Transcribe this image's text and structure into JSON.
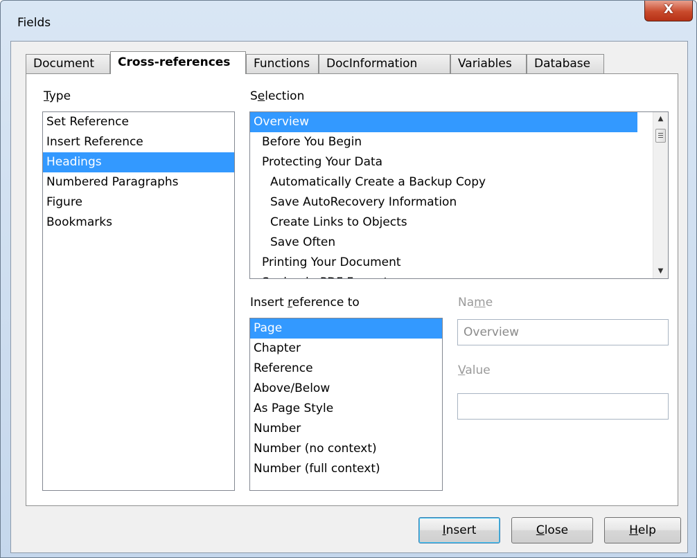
{
  "window": {
    "title": "Fields",
    "close_glyph": "X"
  },
  "tabs": [
    {
      "label": "Document"
    },
    {
      "label": "Cross-references"
    },
    {
      "label": "Functions"
    },
    {
      "label": "DocInformation"
    },
    {
      "label": "Variables"
    },
    {
      "label": "Database"
    }
  ],
  "type": {
    "label_ul": "T",
    "label_rest": "ype",
    "items": [
      "Set Reference",
      "Insert Reference",
      "Headings",
      "Numbered Paragraphs",
      "Figure",
      "Bookmarks"
    ],
    "selected": "Headings"
  },
  "selection": {
    "label_pre": "S",
    "label_ul": "e",
    "label_rest": "lection",
    "items": [
      "Overview",
      "Before You Begin",
      "Protecting Your Data",
      "Automatically Create a Backup Copy",
      "Save AutoRecovery Information",
      "Create Links to Objects",
      "Save Often",
      "Printing Your Document",
      "Saving in PDF Format"
    ],
    "selected": "Overview"
  },
  "insert_reference": {
    "label_pre": "Insert ",
    "label_ul": "r",
    "label_rest": "eference to",
    "items": [
      "Page",
      "Chapter",
      "Reference",
      "Above/Below",
      "As Page Style",
      "Number",
      "Number (no context)",
      "Number (full context)"
    ],
    "selected": "Page"
  },
  "name_field": {
    "label_pre": "Na",
    "label_ul": "m",
    "label_rest": "e",
    "value": "Overview"
  },
  "value_field": {
    "label_ul": "V",
    "label_rest": "alue",
    "value": ""
  },
  "buttons": {
    "insert_ul": "I",
    "insert_rest": "nsert",
    "close_ul": "C",
    "close_rest": "lose",
    "help_ul": "H",
    "help_rest": "elp"
  }
}
